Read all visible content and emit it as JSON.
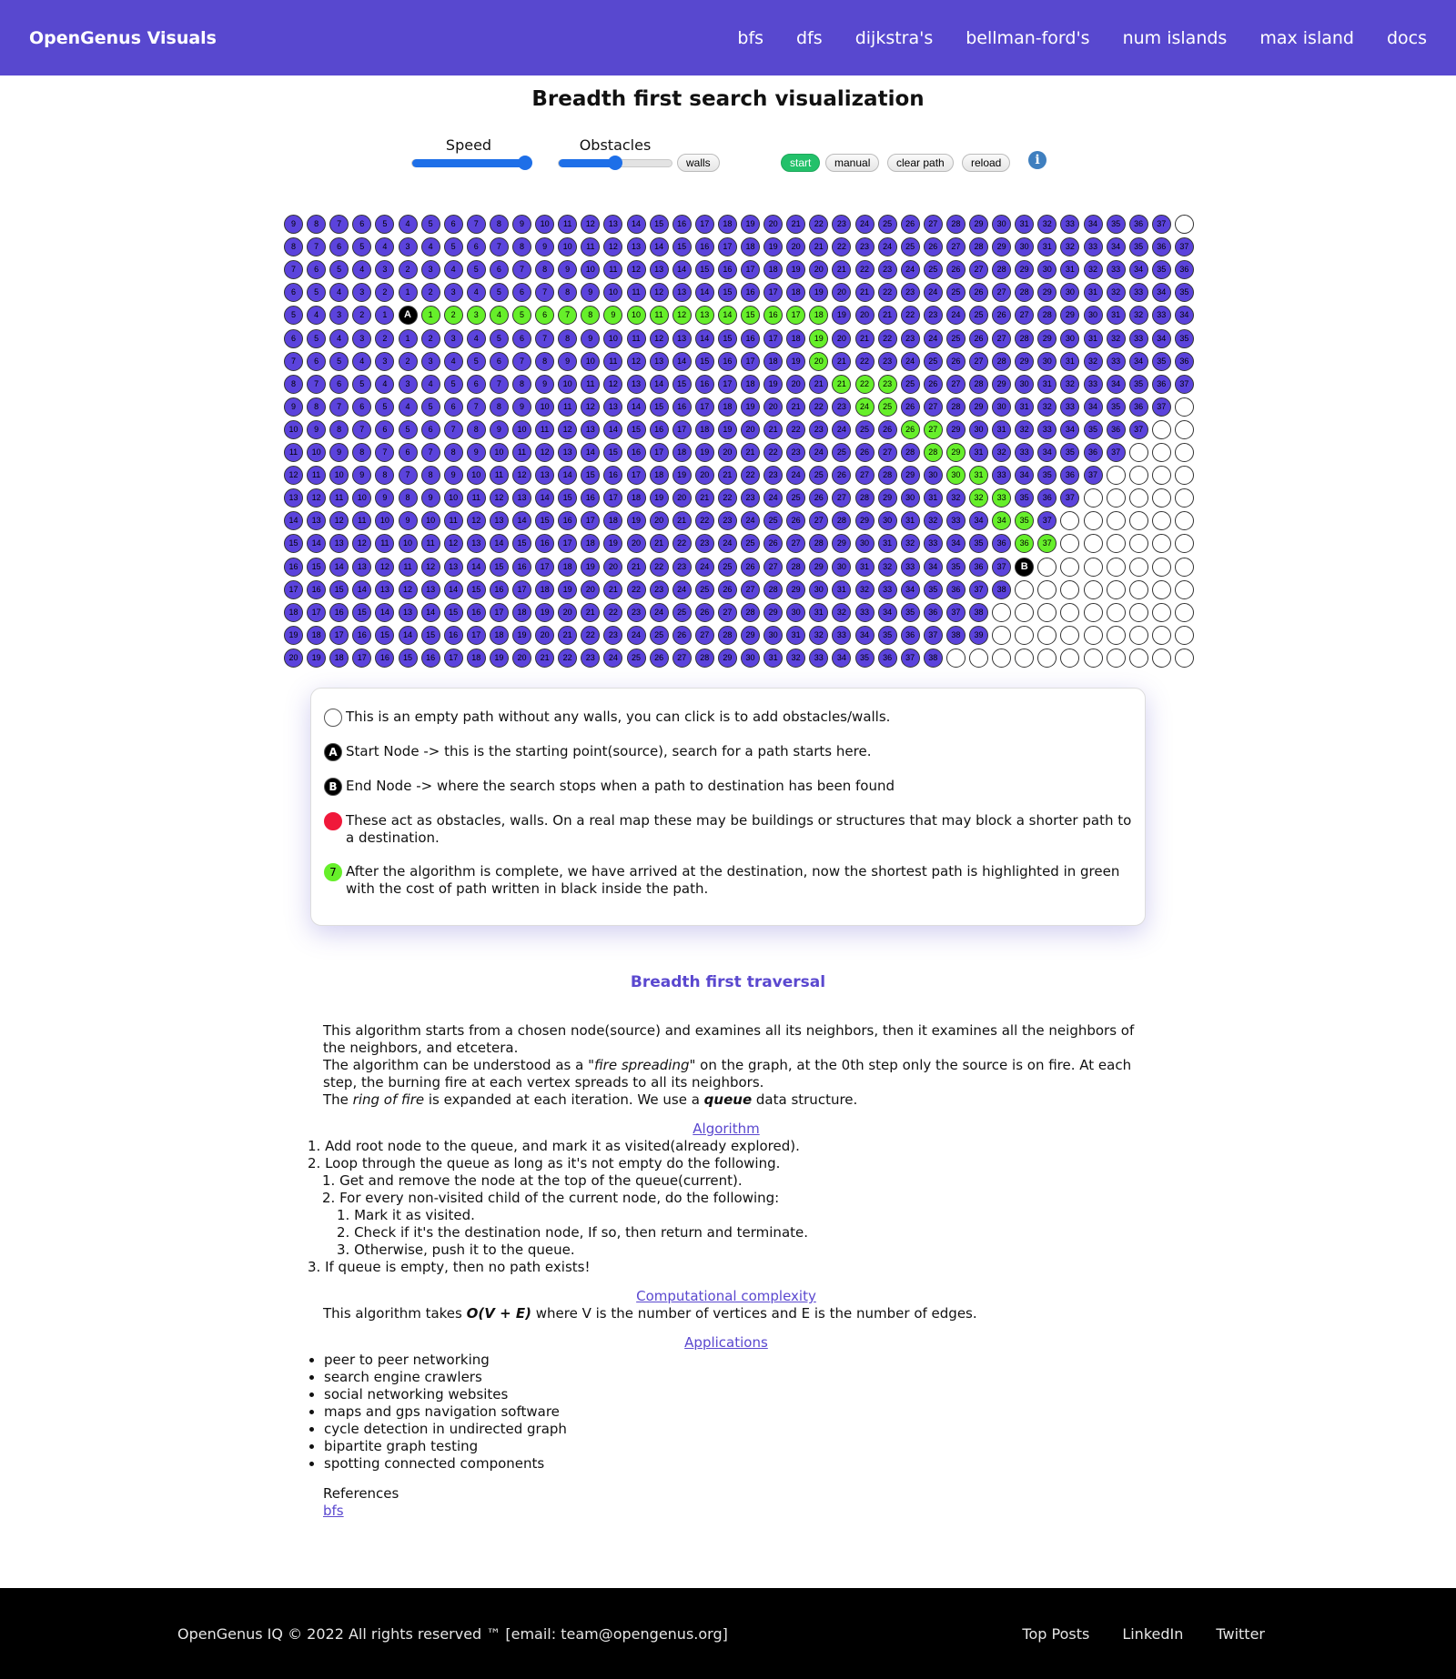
{
  "nav": {
    "brand": "OpenGenus Visuals",
    "links": [
      "bfs",
      "dfs",
      "dijkstra's",
      "bellman-ford's",
      "num islands",
      "max island",
      "docs"
    ]
  },
  "title": "Breadth first search visualization",
  "controls": {
    "speed_label": "Speed",
    "speed_level": 1.0,
    "obstacles_label": "Obstacles",
    "obstacles_level": 0.5,
    "walls_button": "walls",
    "start_button": "start",
    "manual_button": "manual",
    "clear_path_button": "clear path",
    "reload_button": "reload",
    "info_icon": "i"
  },
  "grid": {
    "rows": 20,
    "cols": 40,
    "start": [
      4,
      5
    ],
    "end": [
      15,
      32
    ],
    "start_label": "A",
    "end_label": "B",
    "empty_cells": {
      "0": [
        39
      ],
      "8": [
        39
      ],
      "9": [
        38,
        39
      ],
      "10": [
        37,
        38,
        39
      ],
      "11": [
        36,
        37,
        38,
        39
      ],
      "12": [
        35,
        36,
        37,
        38,
        39
      ],
      "13": [
        34,
        35,
        36,
        37,
        38,
        39
      ],
      "14": [
        33,
        34,
        35,
        36,
        37,
        38,
        39
      ],
      "15": [
        33,
        34,
        35,
        36,
        37,
        38,
        39
      ],
      "16": [
        32,
        33,
        34,
        35,
        36,
        37,
        38,
        39
      ],
      "17": [
        31,
        32,
        33,
        34,
        35,
        36,
        37,
        38,
        39
      ],
      "18": [
        31,
        32,
        33,
        34,
        35,
        36,
        37,
        38,
        39
      ],
      "19": [
        29,
        30,
        31,
        32,
        33,
        34,
        35,
        36,
        37,
        38,
        39
      ]
    },
    "path": [
      [
        4,
        6,
        1
      ],
      [
        4,
        7,
        2
      ],
      [
        4,
        8,
        3
      ],
      [
        4,
        9,
        4
      ],
      [
        4,
        10,
        5
      ],
      [
        4,
        11,
        6
      ],
      [
        4,
        12,
        7
      ],
      [
        4,
        13,
        8
      ],
      [
        4,
        14,
        9
      ],
      [
        4,
        15,
        10
      ],
      [
        4,
        16,
        11
      ],
      [
        4,
        17,
        12
      ],
      [
        4,
        18,
        13
      ],
      [
        4,
        19,
        14
      ],
      [
        4,
        20,
        15
      ],
      [
        4,
        21,
        16
      ],
      [
        4,
        22,
        17
      ],
      [
        4,
        23,
        18
      ],
      [
        5,
        23,
        19
      ],
      [
        6,
        23,
        20
      ],
      [
        7,
        24,
        21
      ],
      [
        7,
        25,
        22
      ],
      [
        7,
        26,
        23
      ],
      [
        8,
        25,
        24
      ],
      [
        8,
        26,
        25
      ],
      [
        9,
        27,
        26
      ],
      [
        9,
        28,
        27
      ],
      [
        10,
        28,
        28
      ],
      [
        10,
        29,
        29
      ],
      [
        11,
        29,
        30
      ],
      [
        11,
        30,
        31
      ],
      [
        12,
        30,
        32
      ],
      [
        12,
        31,
        33
      ],
      [
        13,
        31,
        34
      ],
      [
        13,
        32,
        35
      ],
      [
        14,
        32,
        36
      ],
      [
        14,
        33,
        37
      ]
    ]
  },
  "legend": [
    {
      "type": "empty",
      "mark": "",
      "text": "This is an empty path without any walls, you can click is to add obstacles/walls."
    },
    {
      "type": "node",
      "mark": "A",
      "text": "Start Node -> this is the starting point(source), search for a path starts here."
    },
    {
      "type": "node",
      "mark": "B",
      "text": "End Node -> where the search stops when a path to destination has been found"
    },
    {
      "type": "wall",
      "mark": "",
      "text": "These act as obstacles, walls. On a real map these may be buildings or structures that may block a shorter path to a destination."
    },
    {
      "type": "path",
      "mark": "7",
      "text": "After the algorithm is complete, we have arrived at the destination, now the shortest path is highlighted in green with the cost of path written in black inside the path."
    }
  ],
  "section": {
    "title": "Breadth first traversal",
    "intro1": "This algorithm starts from a chosen node(source) and examines all its neighbors, then it examines all the neighbors of the neighbors, and etcetera.",
    "intro2_a": "The algorithm can be understood as a ",
    "intro2_b": "\"fire spreading\"",
    "intro2_c": " on the graph, at the 0th step only the source is on fire. At each step, the burning fire at each vertex spreads to all its neighbors.",
    "intro3_a": "The ",
    "intro3_b": "ring of fire",
    "intro3_c": " is expanded at each iteration. We use a ",
    "intro3_d": "queue",
    "intro3_e": " data structure.",
    "algorithm_link": "Algorithm",
    "steps": [
      "1. Add root node to the queue, and mark it as visited(already explored).",
      "2. Loop through the queue as long as it's not empty do the following.",
      "1. Get and remove the node at the top of the queue(current).",
      "2. For every non-visited child of the current node, do the following:",
      "1. Mark it as visited.",
      "2. Check if it's the destination node, If so, then return and terminate.",
      "3. Otherwise, push it to the queue.",
      "3. If queue is empty, then no path exists!"
    ],
    "complexity_link": "Computational complexity",
    "complexity_a": "This algorithm takes ",
    "complexity_b": "O(V + E)",
    "complexity_c": " where V is the number of vertices and E is the number of edges.",
    "applications_link": "Applications",
    "applications": [
      "peer to peer networking",
      "search engine crawlers",
      "social networking websites",
      "maps and gps navigation software",
      "cycle detection in undirected graph",
      "bipartite graph testing",
      "spotting connected components"
    ],
    "references_label": "References",
    "references_link": "bfs"
  },
  "footer": {
    "copyright": "OpenGenus IQ © 2022 All rights reserved ™ [email: team@opengenus.org]",
    "links": [
      "Top Posts",
      "LinkedIn",
      "Twitter"
    ]
  },
  "colors": {
    "nav": "#5848cf",
    "visited": "#5b43dc",
    "path": "#66ef2a",
    "wall": "#f0183a",
    "start_button": "#23c16a"
  }
}
